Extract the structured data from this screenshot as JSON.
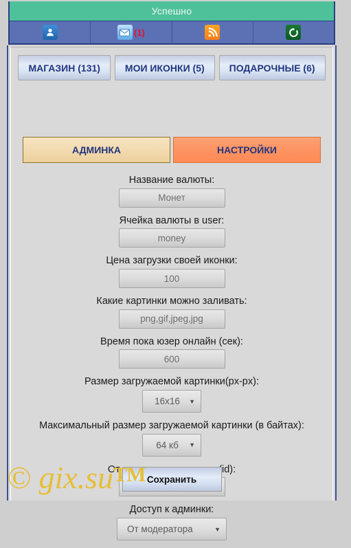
{
  "status": {
    "message": "Успешно",
    "bg_color": "#4ec19a"
  },
  "toolbar": {
    "items": [
      {
        "icon": "user-icon",
        "label": ""
      },
      {
        "icon": "mail-icon",
        "label": "(1)"
      },
      {
        "icon": "rss-icon",
        "label": ""
      },
      {
        "icon": "reload-icon",
        "label": ""
      }
    ]
  },
  "nav": {
    "tabs": [
      {
        "label": "МАГАЗИН (131)"
      },
      {
        "label": "МОИ ИКОНКИ (5)"
      },
      {
        "label": "ПОДАРОЧНЫЕ (6)"
      }
    ]
  },
  "modes": {
    "admin_label": "АДМИНКА",
    "settings_label": "НАСТРОЙКИ",
    "admin_color": "#f3dcb2",
    "settings_color": "#fd9463"
  },
  "form": {
    "fields": [
      {
        "label": "Название валюты:",
        "value": "Монет",
        "type": "text"
      },
      {
        "label": "Ячейка валюты в user:",
        "value": "money",
        "type": "text"
      },
      {
        "label": "Цена загрузки своей иконки:",
        "value": "100",
        "type": "text"
      },
      {
        "label": "Какие картинки можно заливать:",
        "value": "png,gif,jpeg,jpg",
        "type": "text"
      },
      {
        "label": "Время пока юзер онлайн (сек):",
        "value": "600",
        "type": "text"
      },
      {
        "label": "Размер загружаемой картинки(px-px):",
        "value": "16x16",
        "type": "select"
      },
      {
        "label": "Максимальный размер загружаемой картинки (в байтах):",
        "value": "64 кб",
        "type": "select"
      },
      {
        "label": "От кого приходит почта (id):",
        "value": "0",
        "type": "text"
      },
      {
        "label": "Доступ к админки:",
        "value": "От модератора",
        "type": "select"
      }
    ],
    "save_label": "Сохранить"
  },
  "watermark": {
    "text": "© gix.su",
    "tm": "TM",
    "color": "#e8bc2a"
  }
}
